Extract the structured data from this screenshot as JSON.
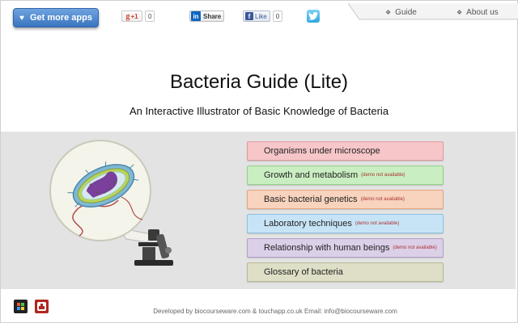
{
  "header": {
    "get_apps_label": "Get more apps",
    "gplus_label": "+1",
    "gplus_count": "0",
    "linkedin_label": "Share",
    "facebook_label": "Like",
    "facebook_count": "0",
    "tabs": [
      {
        "label": "Guide"
      },
      {
        "label": "About us"
      }
    ]
  },
  "main": {
    "title": "Bacteria Guide (Lite)",
    "subtitle": "An Interactive Illustrator of Basic Knowledge of Bacteria"
  },
  "menu": {
    "items": [
      {
        "label": "Organisms under microscope",
        "note": "",
        "color": "#f6c6c9",
        "border": "#e29aa0"
      },
      {
        "label": "Growth and metabolism",
        "note": "(demo not available)",
        "color": "#c9eec1",
        "border": "#93cf88"
      },
      {
        "label": "Basic bacterial genetics",
        "note": "(demo not available)",
        "color": "#f8d3bd",
        "border": "#e0a582"
      },
      {
        "label": "Laboratory techniques",
        "note": "(demo not available)",
        "color": "#c7e4f6",
        "border": "#8cc1e2"
      },
      {
        "label": "Relationship with human beings",
        "note": "(demo not available)",
        "color": "#dccfe8",
        "border": "#b3a0cc"
      },
      {
        "label": "Glossary of bacteria",
        "note": "",
        "color": "#dedfc6",
        "border": "#b8ba94"
      }
    ]
  },
  "footer": {
    "text": "Developed by biocourseware.com & touchapp.co.uk Email: info@biocourseware.com"
  },
  "colors": {
    "accent": "#3b74c0",
    "panel": "#e3e3e3"
  },
  "icons": [
    "heart-icon",
    "google-plus-icon",
    "linkedin-icon",
    "facebook-icon",
    "twitter-bird-icon",
    "star-icon",
    "bacterium-icon",
    "microscope-icon",
    "colorful-app-icon",
    "red-app-icon"
  ]
}
